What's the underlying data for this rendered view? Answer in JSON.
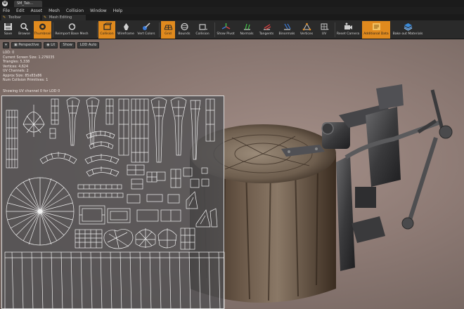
{
  "window": {
    "tab_title": "SM_Tab...",
    "logo": "U"
  },
  "menu": [
    "File",
    "Edit",
    "Asset",
    "Mesh",
    "Collision",
    "Window",
    "Help"
  ],
  "panels": [
    {
      "label": "Toolbar",
      "icon": "toolbar-icon"
    },
    {
      "label": "Mesh Editing",
      "icon": "mesh-editing-icon"
    }
  ],
  "toolbar": {
    "buttons": [
      {
        "id": "save",
        "label": "Save",
        "icon": "save-icon",
        "active": false
      },
      {
        "id": "browse",
        "label": "Browse",
        "icon": "browse-icon",
        "active": false
      },
      {
        "id": "thumbnail",
        "label": "Thumbnail",
        "icon": "thumbnail-icon",
        "active": true
      },
      {
        "id": "reimport",
        "label": "Reimport Base Mesh",
        "icon": "reimport-icon",
        "active": false
      },
      {
        "id": "collision",
        "label": "Collision",
        "icon": "collision-icon",
        "active": true
      },
      {
        "id": "wireframe",
        "label": "Wireframe",
        "icon": "wireframe-icon",
        "active": false
      },
      {
        "id": "vertcolors",
        "label": "Vert Colors",
        "icon": "vert-colors-icon",
        "active": false
      },
      {
        "id": "grid",
        "label": "Grid",
        "icon": "grid-icon",
        "active": true
      },
      {
        "id": "bounds",
        "label": "Bounds",
        "icon": "bounds-icon",
        "active": false
      },
      {
        "id": "collisionmenu",
        "label": "Collision",
        "icon": "collision-menu-icon",
        "active": false
      },
      {
        "id": "showpivot",
        "label": "Show Pivot",
        "icon": "show-pivot-icon",
        "active": false
      },
      {
        "id": "normals",
        "label": "Normals",
        "icon": "normals-icon",
        "active": false
      },
      {
        "id": "tangents",
        "label": "Tangents",
        "icon": "tangents-icon",
        "active": false
      },
      {
        "id": "binormals",
        "label": "Binormals",
        "icon": "binormals-icon",
        "active": false
      },
      {
        "id": "vertices",
        "label": "Vertices",
        "icon": "vertices-icon",
        "active": false
      },
      {
        "id": "uv",
        "label": "UV",
        "icon": "uv-icon",
        "active": false
      },
      {
        "id": "resetcamera",
        "label": "Reset Camera",
        "icon": "reset-camera-icon",
        "active": false
      },
      {
        "id": "additionaldata",
        "label": "Additional Data",
        "icon": "additional-data-icon",
        "active": true
      },
      {
        "id": "bakeout",
        "label": "Bake out Materials",
        "icon": "bake-out-materials-icon",
        "active": false
      }
    ]
  },
  "viewport": {
    "buttons": [
      "▾",
      "Perspective",
      "Lit",
      "Show",
      "LOD Auto"
    ],
    "stats": [
      "LOD: 0",
      "Current Screen Size: 1.276035",
      "Triangles: 5,338",
      "Vertices: 4,624",
      "UV Channels: 2",
      "Approx Size: 85x83x86",
      "Num Collision Primitives: 1"
    ],
    "uv_caption": "Showing UV channel 0 for LOD 0"
  },
  "colors": {
    "accent": "#e08a1e",
    "toolbar_bg": "#2a2a2a",
    "viewport_bg": "#8d7a74"
  }
}
